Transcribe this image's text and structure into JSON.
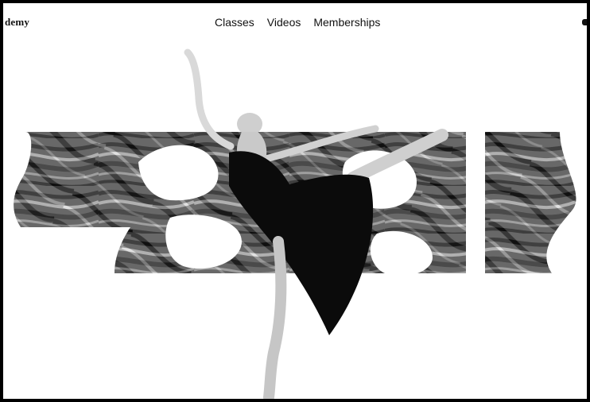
{
  "header": {
    "brand_fragment": "demy",
    "nav": [
      {
        "label": "Classes"
      },
      {
        "label": "Videos"
      },
      {
        "label": "Memberships"
      }
    ]
  },
  "hero": {
    "background_word_fragment": "Lear",
    "image": "ballet-dancer-arabesque",
    "colors": {
      "page": "#ffffff",
      "ink": "#111111",
      "marble_dark": "#1a1a1a",
      "marble_light": "#d8d8d8"
    }
  }
}
